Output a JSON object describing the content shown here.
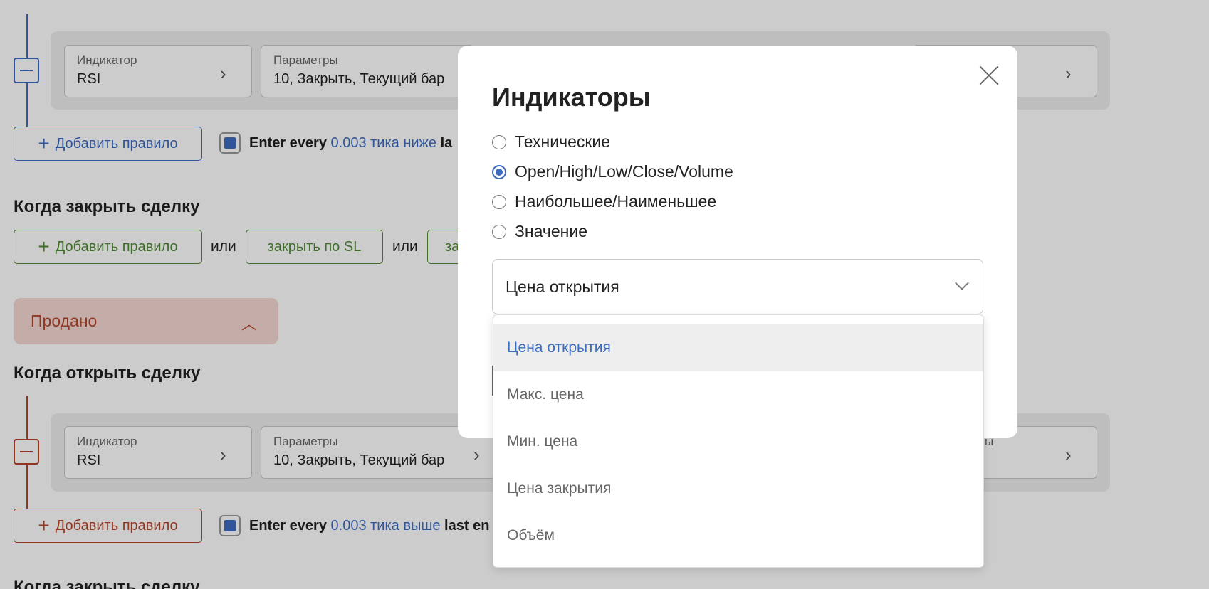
{
  "background": {
    "buy_rule": {
      "indicator_label": "Индикатор",
      "indicator_value": "RSI",
      "params_label": "Параметры",
      "params_value": "10, Закрыть, Текущий бар"
    },
    "add_rule_label": "Добавить правило",
    "enter_text_buy": {
      "prefix": "Enter every ",
      "highlight": "0.003 тика ниже",
      "suffix": " la"
    },
    "close_section_title": "Когда закрыть сделку",
    "or_label": "или",
    "close_by_sl_label": "закрыть по SL",
    "close_cut_label": "за",
    "sold_panel_title": "Продано",
    "open_section_title": "Когда открыть сделку",
    "sell_rule": {
      "indicator_label": "Индикатор",
      "indicator_value": "RSI",
      "params_label": "Параметры",
      "params_value": "10, Закрыть, Текущий бар",
      "extra_label_cut": "ы"
    },
    "enter_text_sell": {
      "prefix": "Enter every ",
      "highlight": "0.003 тика выше",
      "suffix": " last en"
    },
    "close_section_title_2": "Когда закрыть сделку"
  },
  "modal": {
    "title": "Индикаторы",
    "radio_options": [
      {
        "label": "Технические",
        "selected": false
      },
      {
        "label": "Open/High/Low/Close/Volume",
        "selected": true
      },
      {
        "label": "Наибольшее/Наименьшее",
        "selected": false
      },
      {
        "label": "Значение",
        "selected": false
      }
    ],
    "select_value": "Цена открытия",
    "dropdown_options": [
      {
        "label": "Цена открытия",
        "active": true
      },
      {
        "label": "Макс. цена",
        "active": false
      },
      {
        "label": "Мин. цена",
        "active": false
      },
      {
        "label": "Цена закрытия",
        "active": false
      },
      {
        "label": "Объём",
        "active": false
      }
    ]
  },
  "colors": {
    "accent_blue": "#3d6cc0",
    "accent_green": "#4e8a34",
    "accent_red": "#b5472c"
  }
}
